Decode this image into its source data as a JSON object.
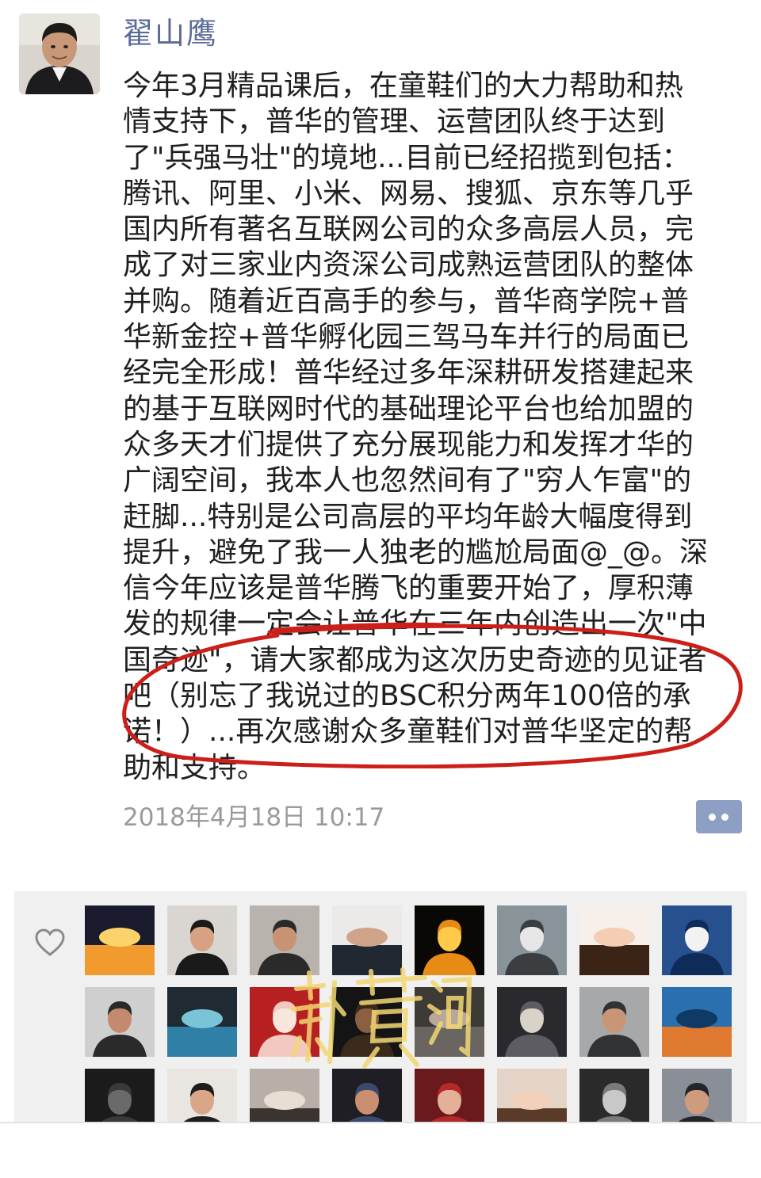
{
  "post": {
    "author": "翟山鹰",
    "lines": [
      "今年3月精品课后，在童鞋们的大力帮助和热",
      "情支持下，普华的管理、运营团队终于达到",
      "了\"兵强马壮\"的境地...目前已经招揽到包括：",
      "腾讯、阿里、小米、网易、搜狐、京东等几乎",
      "国内所有著名互联网公司的众多高层人员，完",
      "成了对三家业内资深公司成熟运营团队的整体",
      "并购。随着近百高手的参与，普华商学院+普",
      "华新金控+普华孵化园三驾马车并行的局面已",
      "经完全形成！普华经过多年深耕研发搭建起来",
      "的基于互联网时代的基础理论平台也给加盟的",
      "众多天才们提供了充分展现能力和发挥才华的",
      "广阔空间，我本人也忽然间有了\"穷人乍富\"的",
      "赶脚...特别是公司高层的平均年龄大幅度得到",
      "提升，避免了我一人独老的尴尬局面@_@。深",
      "信今年应该是普华腾飞的重要开始了，厚积薄",
      "发的规律一定会让普华在三年内创造出一次\"中",
      "国奇迹\"，请大家都成为这次历史奇迹的见证者",
      "吧（别忘了我说过的BSC积分两年100倍的承",
      "诺！）...再次感谢众多童鞋们对普华坚定的帮",
      "助和支持。"
    ],
    "timestamp": "2018年4月18日 10:17"
  },
  "likes": {
    "icon": "heart-outline-icon",
    "avatars": [
      "sunset",
      "man-suit",
      "man-selfie",
      "man-tie",
      "infinity-neon",
      "landscape",
      "cartoon-woman",
      "blue-text-card",
      "group-photo",
      "phone-screens",
      "cartoon-pig",
      "dark-room",
      "street-scene",
      "conference",
      "man-portrait",
      "pavilion-sunset",
      "dark-interior",
      "young-man",
      "meeting",
      "man-dark",
      "woman-red",
      "woman-selfie",
      "black-white",
      "man-glasses"
    ]
  },
  "watermark": {
    "text": "新黄河"
  },
  "colors": {
    "author": "#5b6b96",
    "text": "#1f1f1f",
    "timestamp": "#9a9a9a",
    "more_button": "#8da0c4",
    "circle_mark": "#cc1f1a",
    "likes_bg": "#f0f0f0",
    "watermark": "#f2d774"
  }
}
